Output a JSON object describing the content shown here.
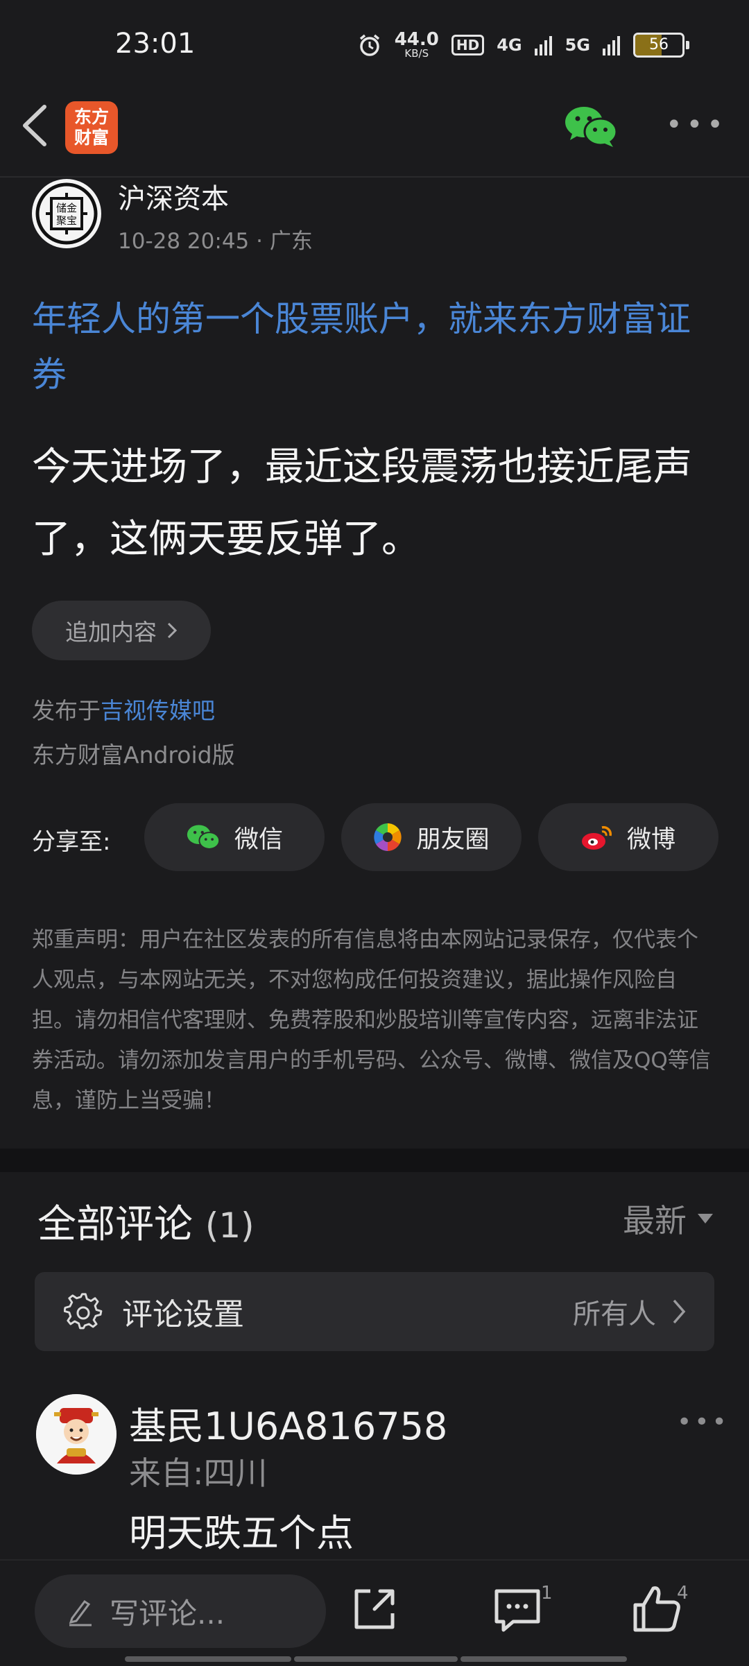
{
  "status_bar": {
    "time": "23:01",
    "net_speed": "44.0",
    "net_speed_unit": "KB/S",
    "hd_label": "HD",
    "signal_1": "4G",
    "signal_2": "5G",
    "battery": "56"
  },
  "nav": {
    "app_logo_line1": "东方",
    "app_logo_line2": "财富"
  },
  "post": {
    "author": "沪深资本",
    "avatar_text": "储金\n聚宝",
    "time": "10-28 20:45",
    "location": "· 广东",
    "promo_link": "年轻人的第一个股票账户，就来东方财富证券",
    "content": "今天进场了，最近这段震荡也接近尾声了，这俩天要反弹了。",
    "append_button": "追加内容",
    "published_prefix": "发布于",
    "published_board": "吉视传媒吧",
    "platform": "东方财富Android版"
  },
  "share": {
    "label": "分享至:",
    "wechat": "微信",
    "moments": "朋友圈",
    "weibo": "微博"
  },
  "disclaimer": "郑重声明：用户在社区发表的所有信息将由本网站记录保存，仅代表个人观点，与本网站无关，不对您构成任何投资建议，据此操作风险自担。请勿相信代客理财、免费荐股和炒股培训等宣传内容，远离非法证券活动。请勿添加发言用户的手机号码、公众号、微博、微信及QQ等信息，谨防上当受骗！",
  "comments": {
    "title": "全部评论",
    "count": "(1)",
    "sort": "最新",
    "settings_label": "评论设置",
    "settings_value": "所有人",
    "items": [
      {
        "name": "基民1U6A816758",
        "location": "来自:四川",
        "text": "明天跌五个点"
      }
    ]
  },
  "bottom_bar": {
    "write_placeholder": "写评论...",
    "comment_count": "1",
    "like_count": "4"
  },
  "colors": {
    "accent_link": "#4a86d6",
    "brand": "#e8572a",
    "background": "#1b1b1d"
  }
}
